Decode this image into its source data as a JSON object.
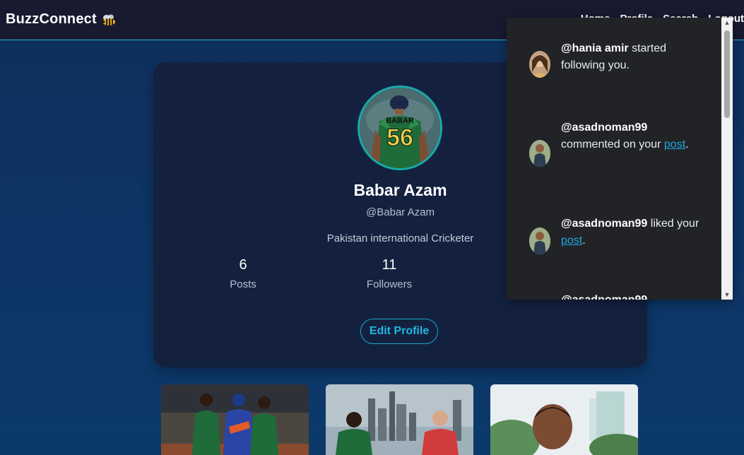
{
  "app": {
    "brand": "BuzzConnect",
    "brand_icon": "bee-icon",
    "accent": "#1fb6d6"
  },
  "nav": {
    "items": [
      "Home",
      "Profile",
      "Search",
      "Logout"
    ]
  },
  "profile": {
    "name": "Babar Azam",
    "handle": "@Babar Azam",
    "bio": "Pakistan international Cricketer",
    "jersey_name": "BABAR",
    "jersey_number": "56",
    "stats": [
      {
        "value": "6",
        "label": "Posts"
      },
      {
        "value": "11",
        "label": "Followers"
      }
    ],
    "edit_label": "Edit Profile"
  },
  "notifications": [
    {
      "user": "@hania amir",
      "text": " started following you.",
      "link": "",
      "suffix": ""
    },
    {
      "user": "@asadnoman99",
      "text": " commented on your ",
      "link": "post",
      "suffix": "."
    },
    {
      "user": "@asadnoman99",
      "text": " liked your ",
      "link": "post",
      "suffix": "."
    },
    {
      "user": "@asadnoman99",
      "text": "",
      "link": "",
      "suffix": ""
    }
  ],
  "posts": [
    {
      "alt": "post-1"
    },
    {
      "alt": "post-2"
    },
    {
      "alt": "post-3"
    }
  ]
}
